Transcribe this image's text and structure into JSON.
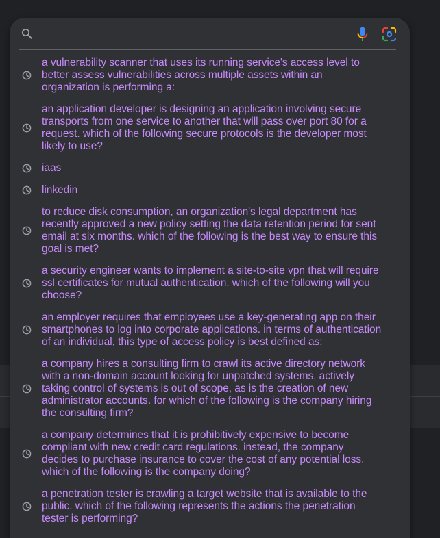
{
  "search": {
    "value": "",
    "placeholder": ""
  },
  "icons": {
    "search": "search-icon",
    "mic": "microphone-icon",
    "lens": "google-lens-icon",
    "history": "clock-history-icon"
  },
  "colors": {
    "panel_bg": "#303134",
    "page_bg": "#202124",
    "suggestion_text": "#c58af9",
    "icon_gray": "#9aa0a6"
  },
  "suggestions": [
    {
      "text": "a vulnerability scanner that uses its running service's access level to better assess vulnerabilities across multiple assets within an organization is performing a:"
    },
    {
      "text": "an application developer is designing an application involving secure transports from one service to another that will pass over port 80 for a request. which of the following secure protocols is the developer most likely to use?"
    },
    {
      "text": "iaas"
    },
    {
      "text": "linkedin"
    },
    {
      "text": "to reduce disk consumption, an organization's legal department has recently approved a new policy setting the data retention period for sent email at six months. which of the following is the best way to ensure this goal is met?"
    },
    {
      "text": "a security engineer wants to implement a site-to-site vpn that will require ssl certificates for mutual authentication. which of the following will you choose?"
    },
    {
      "text": "an employer requires that employees use a key-generating app on their smartphones to log into corporate applications. in terms of authentication of an individual, this type of access policy is best defined as:"
    },
    {
      "text": "a company hires a consulting firm to crawl its active directory network with a non-domain account looking for unpatched systems. actively taking control of systems is out of scope, as is the creation of new administrator accounts. for which of the following is the company hiring the consulting firm?"
    },
    {
      "text": "a company determines that it is prohibitively expensive to become compliant with new credit card regulations. instead, the company decides to purchase insurance to cover the cost of any potential loss. which of the following is the company doing?"
    },
    {
      "text": "a penetration tester is crawling a target website that is available to the public. which of the following represents the actions the penetration tester is performing?"
    }
  ]
}
